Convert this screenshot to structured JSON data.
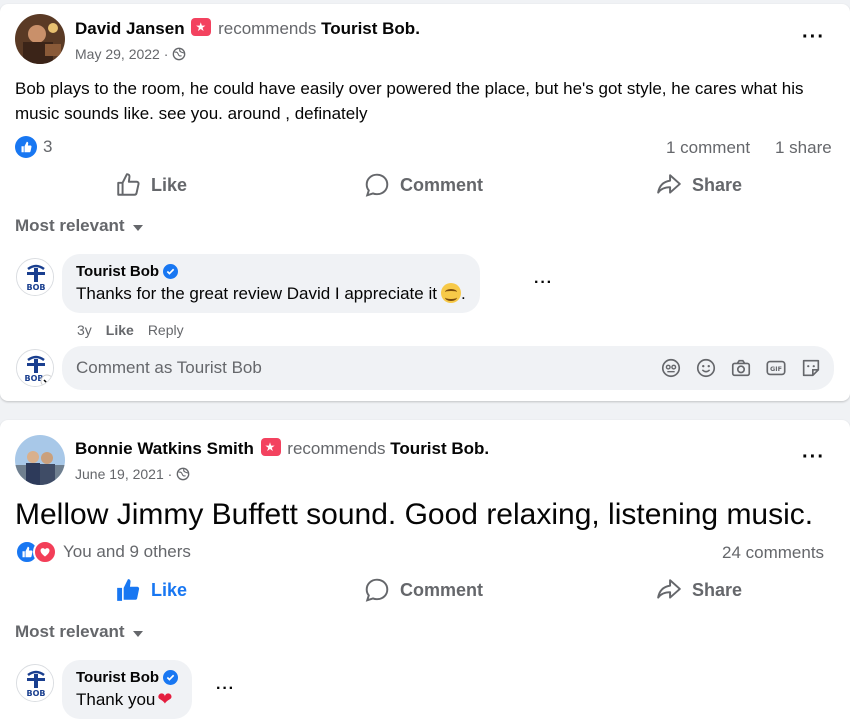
{
  "posts": [
    {
      "author": "David Jansen",
      "recommends_text": "recommends",
      "page_name": "Tourist Bob",
      "date": "May 29, 2022 ·",
      "text": "Bob plays to the room, he could have easily over powered the place, but he's got style, he cares what his music sounds like. see you. around , definately",
      "reaction_count": "3",
      "comments_count": "1 comment",
      "shares_count": "1 share",
      "actions": {
        "like": "Like",
        "comment": "Comment",
        "share": "Share"
      },
      "sort_label": "Most relevant",
      "comment": {
        "author": "Tourist Bob",
        "text": "Thanks for the great review David I appreciate it",
        "age": "3y",
        "like": "Like",
        "reply": "Reply"
      },
      "composer_placeholder": "Comment as Tourist Bob"
    },
    {
      "author": "Bonnie Watkins Smith",
      "recommends_text": "recommends",
      "page_name": "Tourist Bob",
      "date": "June 19, 2021 ·",
      "text": "Mellow Jimmy Buffett sound. Good relaxing, listening music.",
      "reaction_summary": "You and 9 others",
      "comments_count": "24 comments",
      "actions": {
        "like": "Like",
        "comment": "Comment",
        "share": "Share"
      },
      "sort_label": "Most relevant",
      "comment": {
        "author": "Tourist Bob",
        "text": "Thank you"
      }
    }
  ],
  "colors": {
    "brand_blue": "#1877f2",
    "muted": "#65676b",
    "bubble": "#f0f2f5",
    "love_red": "#f33e58",
    "badge_pink": "#f3425f"
  },
  "icons": [
    "more-icon",
    "globe-icon",
    "like-reaction-icon",
    "love-reaction-icon",
    "thumbs-up-icon",
    "comment-icon",
    "share-icon",
    "caret-down-icon",
    "verified-icon",
    "avatar-sticker-icon",
    "emoji-icon",
    "camera-icon",
    "gif-icon",
    "sticker-icon"
  ]
}
